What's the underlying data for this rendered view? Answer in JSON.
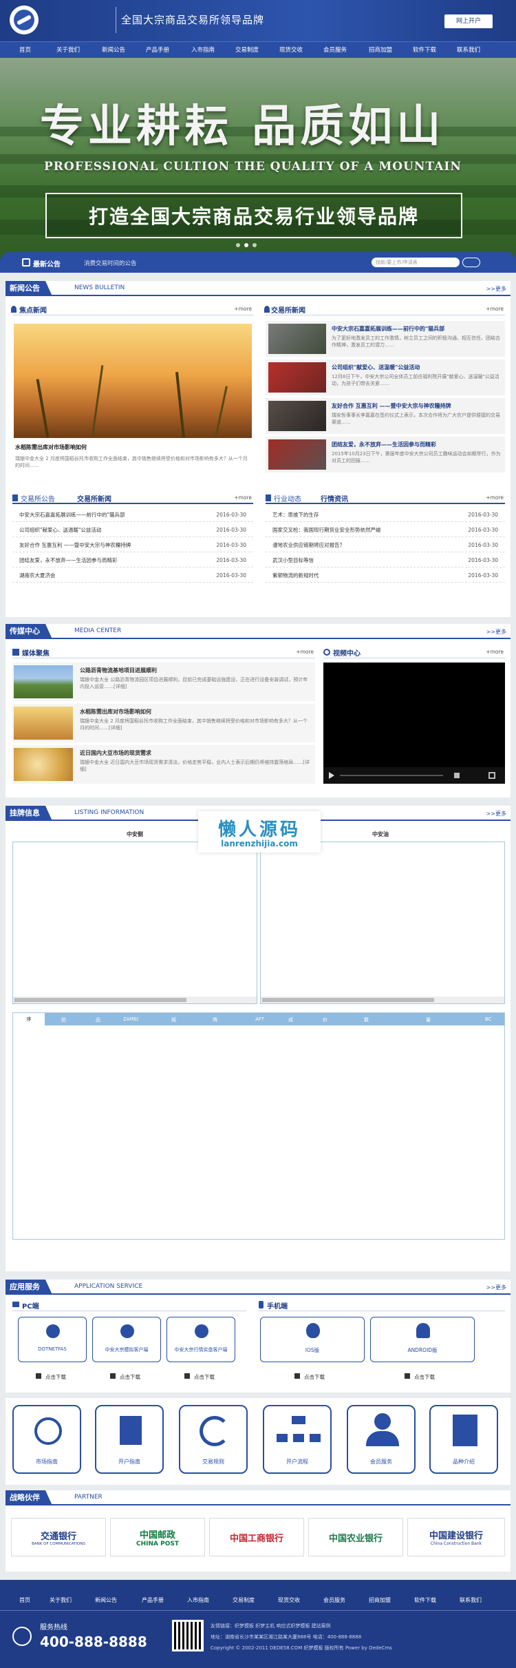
{
  "header": {
    "site_title": "全国大宗商品交易所领导品牌",
    "open_account": "网上开户"
  },
  "nav": [
    "首页",
    "关于我们",
    "新闻公告",
    "产品手册",
    "入市指南",
    "交易制度",
    "现货交收",
    "会员服务",
    "招商加盟",
    "软件下载",
    "联系我们"
  ],
  "banner": {
    "slogan": "专业耕耘  品质如山",
    "slogan_en": "PROFESSIONAL CULTION THE QUALITY OF A MOUNTAIN",
    "box_text": "打造全国大宗商品交易行业领导品牌"
  },
  "notice": {
    "label": "最新公告",
    "text": "消费交易时间的公告",
    "search_placeholder": "找新/要上市/申请表"
  },
  "news": {
    "title": "新闻公告",
    "en": "NEWS BULLETIN",
    "more": ">>更多",
    "focus": {
      "title": "焦点新闻",
      "more": "+more",
      "caption": "水稻陈需出库对市场影响如何",
      "desc": "瑞银中金大全 2 月度将国稻谷托市收购工作全面结束，其中销售继续将受价格和对市场影响有多大？从一个月的时间……"
    },
    "exchange": {
      "title": "交易所新闻",
      "more": "+more",
      "items": [
        {
          "title": "中安大宗石嘉嘉拓展训练——前行中的\"猫兵部",
          "desc": "为了更好地激发员工的工作激情，树立员工之间的积极沟通、相互信任、团结合作精神，激发员工的潜力……"
        },
        {
          "title": "公司组织\"献爱心、送温暖\"公益活动",
          "desc": "12月8日下午，中安大宗公司全体员工前往福利院开展\"献爱心、送温暖\"公益活动，为孩子们带去关爱……"
        },
        {
          "title": "友好合作 互惠互利 ——暨中安大宗与神农糧持牌",
          "desc": "瑞安哲事事长李嘉嘉在签约仪式上表示，本次合作将为广大农户提供便捷的交易渠道……"
        },
        {
          "title": "团结友爱，永不放弃——生活因参与而精彩",
          "desc": "2015年10月23日下午，第届年度中安大宗公司员工趣味运动会如期举行，作为对员工的回报……"
        }
      ]
    },
    "announce": {
      "title1": "交易所公告",
      "title2": "交易所新闻",
      "more": "+more",
      "items": [
        {
          "t": "中安大宗石嘉嘉拓展训练——前行中的\"猫兵部",
          "d": "2016-03-30"
        },
        {
          "t": "公司组织\"献爱心、送温暖\"公益活动",
          "d": "2016-03-30"
        },
        {
          "t": "友好合作 互惠互利 ——暨中安大宗与神农糧持牌",
          "d": "2016-03-30"
        },
        {
          "t": "团结友爱，永不放弃——生活因参与而精彩",
          "d": "2016-03-30"
        },
        {
          "t": "湖南农大夏济会",
          "d": "2016-03-30"
        }
      ]
    },
    "industry": {
      "title1": "行业动态",
      "title2": "行情资讯",
      "more": "+more",
      "items": [
        {
          "t": "艺术：思维下的生存",
          "d": "2016-03-30"
        },
        {
          "t": "国家交叉检：我国现行期货业安全形势依然严峻",
          "d": "2016-03-30"
        },
        {
          "t": "漫地农业供应链期将应对报告？",
          "d": "2016-03-30"
        },
        {
          "t": "武汉小型目标等信",
          "d": "2016-03-30"
        },
        {
          "t": "紫顿物流的新规时代",
          "d": "2016-03-30"
        }
      ]
    }
  },
  "media": {
    "title": "传媒中心",
    "en": "MEDIA CENTER",
    "more": ">>更多",
    "focus": {
      "title": "媒体聚焦",
      "more": "+more",
      "items": [
        {
          "title": "公路沥青物流基地项目进展顺利",
          "desc": "瑞银中金大全 公路沥青物流园区项目进展顺利，目前已完成基础设施建设，正在进行设备安装调试，预计年内投入运营……[详细]"
        },
        {
          "title": "水稻陈需出库对市场影响如何",
          "desc": "瑞银中金大全 2 月度将国稻谷托市收购工作全面结束，其中销售继续将受价格和对市场影响有多大？从一个月的时间……[详细]"
        },
        {
          "title": "近日国内大豆市场的现货需求",
          "desc": "瑞银中金大全 近日国内大豆市场现货需求清淡，价格走势平稳，业内人士表示后期仍将维持震荡格局……[详细]"
        }
      ]
    },
    "video": {
      "title": "视频中心",
      "more": "+more"
    }
  },
  "listing": {
    "title": "挂牌信息",
    "en": "LISTING INFORMATION",
    "more": ">>更多",
    "col_left": "中安侧",
    "col_right": "中安油",
    "table_headers": [
      "序",
      "拍",
      "品",
      "ZAMEI",
      "规",
      "牌",
      "AFT",
      "成",
      "价",
      "数",
      "量",
      "BC"
    ]
  },
  "watermark": {
    "cn": "懒人源码",
    "en": "lanrenzhijia.com"
  },
  "apps": {
    "title": "应用服务",
    "en": "APPLICATION SERVICE",
    "more": ">>更多",
    "pc": {
      "title": "PC端",
      "items": [
        {
          "name": "DOTNETFAS",
          "dl": "点击下载"
        },
        {
          "name": "中安大宗模拟客户端",
          "dl": "点击下载"
        },
        {
          "name": "中安大宗行情实盘客户端",
          "dl": "点击下载"
        }
      ]
    },
    "mobile": {
      "title": "手机端",
      "items": [
        {
          "name": "IOS版",
          "dl": "点击下载"
        },
        {
          "name": "ANDROID版",
          "dl": "点击下载"
        }
      ]
    }
  },
  "services": [
    "市场指南",
    "开户指南",
    "交易规则",
    "开户流程",
    "会员服务",
    "品种介绍"
  ],
  "partner": {
    "title": "战略伙伴",
    "en": "PARTNER",
    "banks": [
      {
        "cn": "交通银行",
        "en": "BANK OF COMMUNICATIONS",
        "color": "#1f3c86"
      },
      {
        "cn": "中国邮政",
        "en": "CHINA POST",
        "color": "#0a7b3c"
      },
      {
        "cn": "中国工商银行",
        "en": "",
        "color": "#c1272d"
      },
      {
        "cn": "中国农业银行",
        "en": "",
        "color": "#1a7a4a"
      },
      {
        "cn": "中国建设银行",
        "en": "China Construction Bank",
        "color": "#1f3c86"
      }
    ]
  },
  "footer": {
    "links": [
      "首页",
      "关于我们",
      "新闻公告",
      "产品手册",
      "入市指南",
      "交易制度",
      "现货交收",
      "会员服务",
      "招商加盟",
      "软件下载",
      "联系我们"
    ],
    "hotline_label": "服务热线",
    "hotline": "400-888-8888",
    "info1": "友情链接：织梦模板  织梦主机  响应式织梦模板  建站案例",
    "info2": "地址：湖南省长沙市某某区湘江路某大厦888号  电话：400-888-8888",
    "info3": "Copyright © 2002-2011 DEDE58.COM 织梦模板 版权所有  Power by DedeCms"
  }
}
